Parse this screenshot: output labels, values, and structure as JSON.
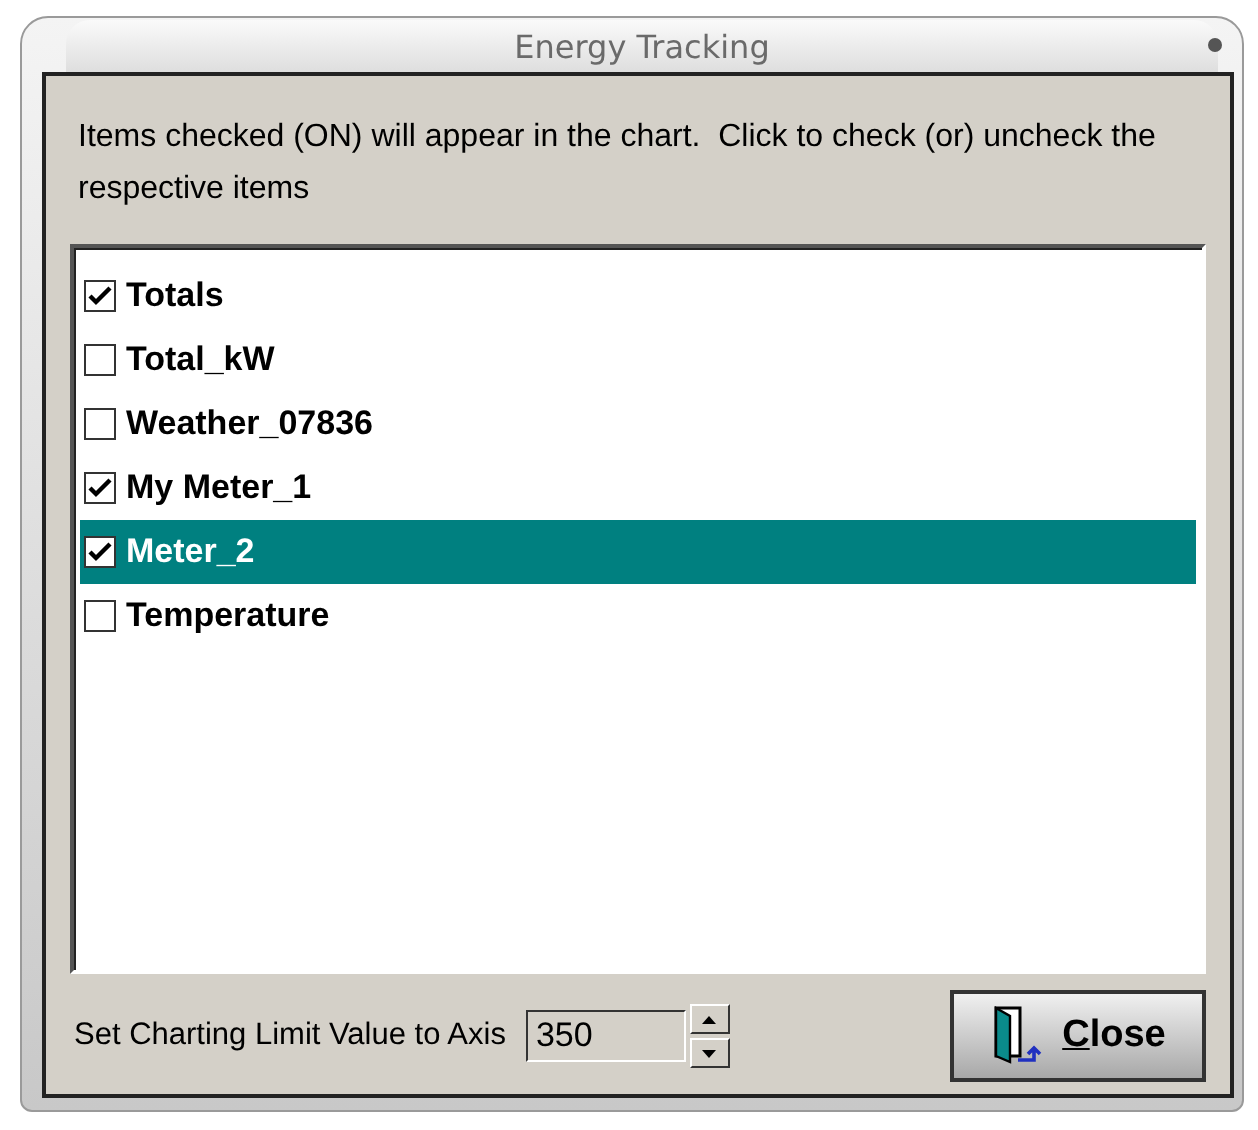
{
  "window": {
    "title": "Energy Tracking"
  },
  "instructions": "Items checked (ON) will appear in the chart.  Click to check (or) uncheck the respective items",
  "items": [
    {
      "label": "Totals",
      "checked": true,
      "selected": false
    },
    {
      "label": "Total_kW",
      "checked": false,
      "selected": false
    },
    {
      "label": "Weather_07836",
      "checked": false,
      "selected": false
    },
    {
      "label": "My Meter_1",
      "checked": true,
      "selected": false
    },
    {
      "label": "Meter_2",
      "checked": true,
      "selected": true
    },
    {
      "label": "Temperature",
      "checked": false,
      "selected": false
    }
  ],
  "limit": {
    "label": "Set Charting Limit Value to Axis",
    "value": "350"
  },
  "buttons": [
    {
      "label": "Close"
    }
  ]
}
